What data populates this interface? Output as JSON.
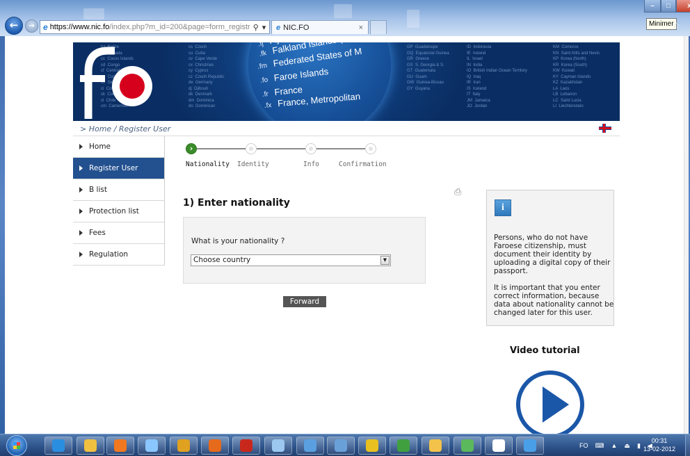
{
  "window": {
    "minimize_tooltip": "Minimer",
    "close_label": "x"
  },
  "browser": {
    "url_host": "https://www.nic.fo",
    "url_rest": "/index.php?m_id=200&page=form_registr",
    "tab_title": "NIC.FO",
    "tab_close": "×"
  },
  "banner": {
    "globe_lines": [
      {
        "code": ".fj",
        "name": "Fiji"
      },
      {
        "code": ".fk",
        "name": "Falkland Islands (Mal"
      },
      {
        "code": ".fm",
        "name": "Federated States of M"
      },
      {
        "code": ".fo",
        "name": "Faroe Islands"
      },
      {
        "code": ".fr",
        "name": "France"
      },
      {
        "code": ".fx",
        "name": "France, Metropolitan"
      }
    ],
    "list_left": "bz  Belize\nca  Canada\ncc  Cocos Islands\ncd  Congo\ncf  Central African\ncg  Congo\nch  Switzerland\nci  Cote d'Ivoire\nck  Cook Islands\ncl  Chile\ncm  Cameroon",
    "list_mid": "cs  Czech\ncu  Cuba\ncv  Cape Verde\ncx  Christmas\ncy  Cyprus\ncz  Czech Republic\nde  Germany\ndj  Djibouti\ndk  Denmark\ndm  Dominica\ndo  Dominican",
    "list_right1": "GP  Guadeloupe\nGQ  Equatorial Guinea\nGR  Greece\nGS  S. Georgia & S.\nGT  Guatemala\nGU  Guam\nGW  Guinea-Bissau\nGY  Guyana",
    "list_right2": "ID  Indonesia\nIE  Ireland\nIL  Israel\nIN  India\nIO  British Indian Ocean Territory\nIQ  Iraq\nIR  Iran\nIS  Iceland\nIT  Italy\nJM  Jamaica\nJO  Jordan",
    "list_right3": "KM  Comoros\nKN  Saint Kitts and Nevis\nKP  Korea (North)\nKR  Korea (South)\nKW  Kuwait\nKY  Cayman Islands\nKZ  Kazakhstan\nLA  Laos\nLB  Lebanon\nLC  Saint Lucia\nLI  Liechtenstein"
  },
  "breadcrumb": "> Home / Register User",
  "nav": [
    {
      "label": "Home",
      "active": false
    },
    {
      "label": "Register User",
      "active": true
    },
    {
      "label": "B list",
      "active": false
    },
    {
      "label": "Protection list",
      "active": false
    },
    {
      "label": "Fees",
      "active": false
    },
    {
      "label": "Regulation",
      "active": false
    }
  ],
  "steps": [
    {
      "label": "Nationality",
      "current": true
    },
    {
      "label": "Identity",
      "current": false
    },
    {
      "label": "Info",
      "current": false
    },
    {
      "label": "Confirmation",
      "current": false
    }
  ],
  "form": {
    "title": "1) Enter nationality",
    "question": "What is your nationality ?",
    "select_value": "Choose country",
    "forward_label": "Forward"
  },
  "info": {
    "paragraph1": "Persons, who do not have Faroese citizenship, must document their identity by uploading a digital copy of their passport.",
    "paragraph2": "It is important that you enter correct information, because data about nationality cannot be changed later for this user."
  },
  "video": {
    "title": "Video tutorial"
  },
  "taskbar": {
    "tray_lang": "FO",
    "time": "00:31",
    "date": "13-02-2012",
    "apps": [
      {
        "name": "ie-icon",
        "color": "#2a8ee0"
      },
      {
        "name": "explorer-icon",
        "color": "#f0c040"
      },
      {
        "name": "media-player-icon",
        "color": "#f07820"
      },
      {
        "name": "paint-icon",
        "color": "#8ac6ff"
      },
      {
        "name": "chrome-icon",
        "color": "#e0a020"
      },
      {
        "name": "firefox-icon",
        "color": "#e66a1c"
      },
      {
        "name": "filezilla-icon",
        "color": "#c8281c"
      },
      {
        "name": "notepad-icon",
        "color": "#9cc8f0"
      },
      {
        "name": "network-icon",
        "color": "#5aa0e0"
      },
      {
        "name": "tool-icon",
        "color": "#6aa0d8"
      },
      {
        "name": "users-icon",
        "color": "#e8c020"
      },
      {
        "name": "green-app-icon",
        "color": "#40a040"
      },
      {
        "name": "folder-icon",
        "color": "#f2c24a"
      },
      {
        "name": "people-icon",
        "color": "#5cb85c"
      },
      {
        "name": "excel-file-icon",
        "color": "#ffffff"
      },
      {
        "name": "app-window-icon",
        "color": "#4aa0e8"
      }
    ]
  }
}
